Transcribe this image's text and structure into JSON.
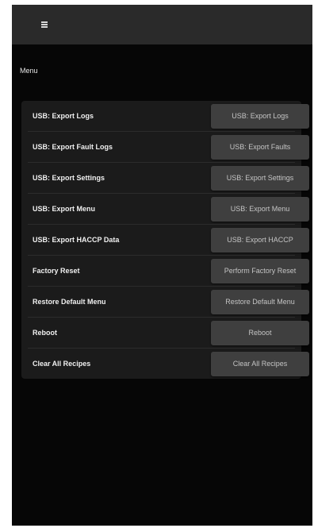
{
  "topbar": {
    "menu_icon": "hamburger-icon"
  },
  "section": {
    "title": "Menu"
  },
  "rows": [
    {
      "label": "USB: Export Logs",
      "button": "USB: Export Logs"
    },
    {
      "label": "USB: Export Fault Logs",
      "button": "USB: Export Faults"
    },
    {
      "label": "USB: Export Settings",
      "button": "USB: Export Settings"
    },
    {
      "label": "USB: Export Menu",
      "button": "USB: Export Menu"
    },
    {
      "label": "USB: Export HACCP Data",
      "button": "USB: Export HACCP"
    },
    {
      "label": "Factory Reset",
      "button": "Perform Factory Reset"
    },
    {
      "label": "Restore Default Menu",
      "button": "Restore Default Menu"
    },
    {
      "label": "Reboot",
      "button": "Reboot"
    },
    {
      "label": "Clear All Recipes",
      "button": "Clear All Recipes"
    }
  ]
}
